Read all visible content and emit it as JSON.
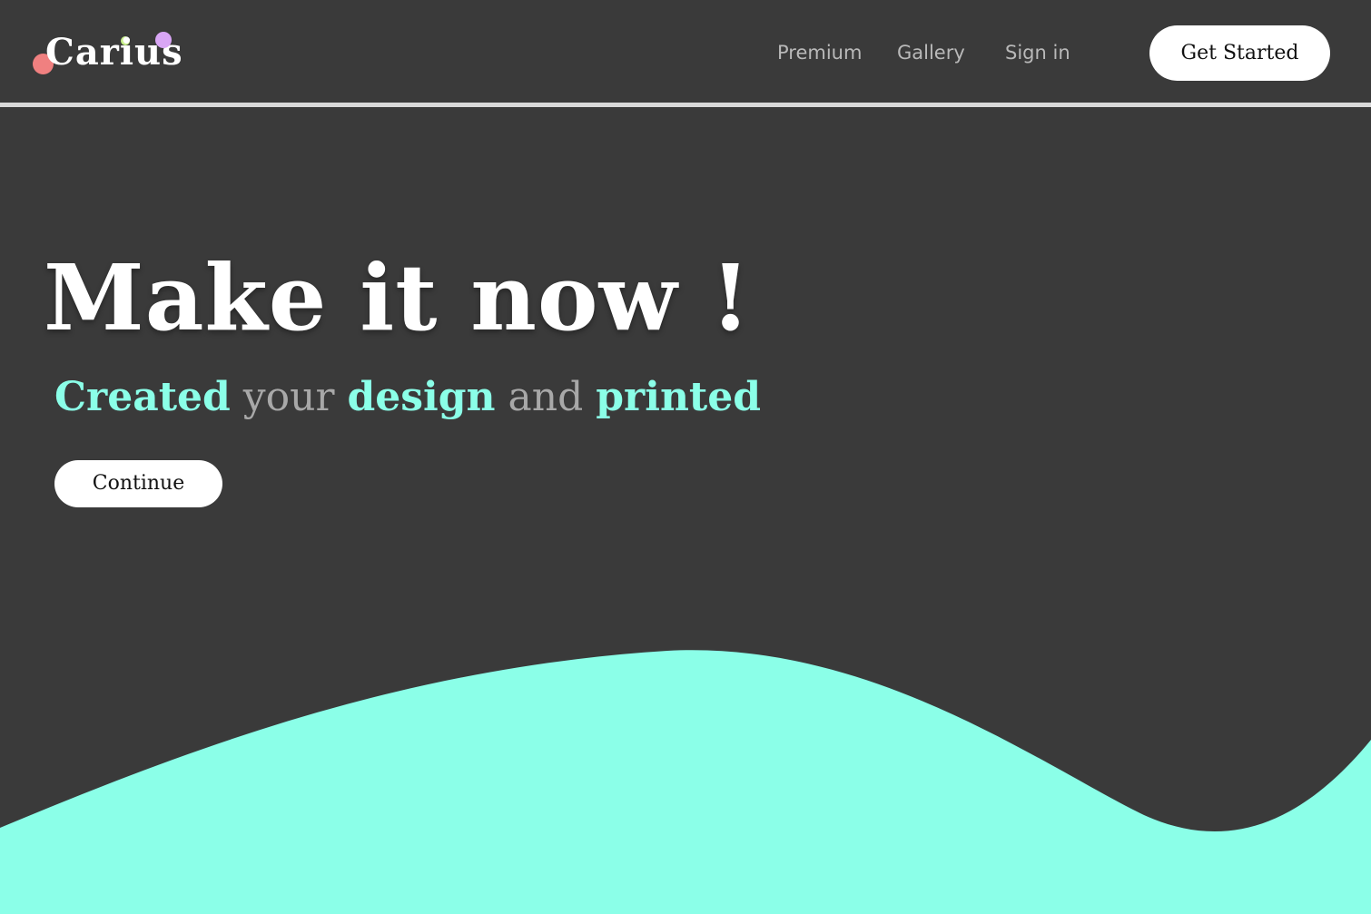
{
  "theme": {
    "background": "#3a3a3a",
    "accent": "#8bffe8",
    "muted_text": "#a8a8a8",
    "nav_text": "#b9b9b9",
    "divider": "#d9d9d9",
    "button_bg": "#ffffff",
    "logo_dots": {
      "coral": "#f08080",
      "lime": "#c8f08a",
      "violet": "#d9a6f5"
    }
  },
  "header": {
    "logo_text": "Carius",
    "nav": {
      "premium": "Premium",
      "gallery": "Gallery",
      "sign_in": "Sign in"
    },
    "cta_label": "Get Started"
  },
  "hero": {
    "title": "Make it now  !",
    "subtitle": {
      "word1": "Created",
      "word2": "your",
      "word3": "design",
      "word4": "and",
      "word5": "printed"
    },
    "continue_label": "Continue"
  }
}
